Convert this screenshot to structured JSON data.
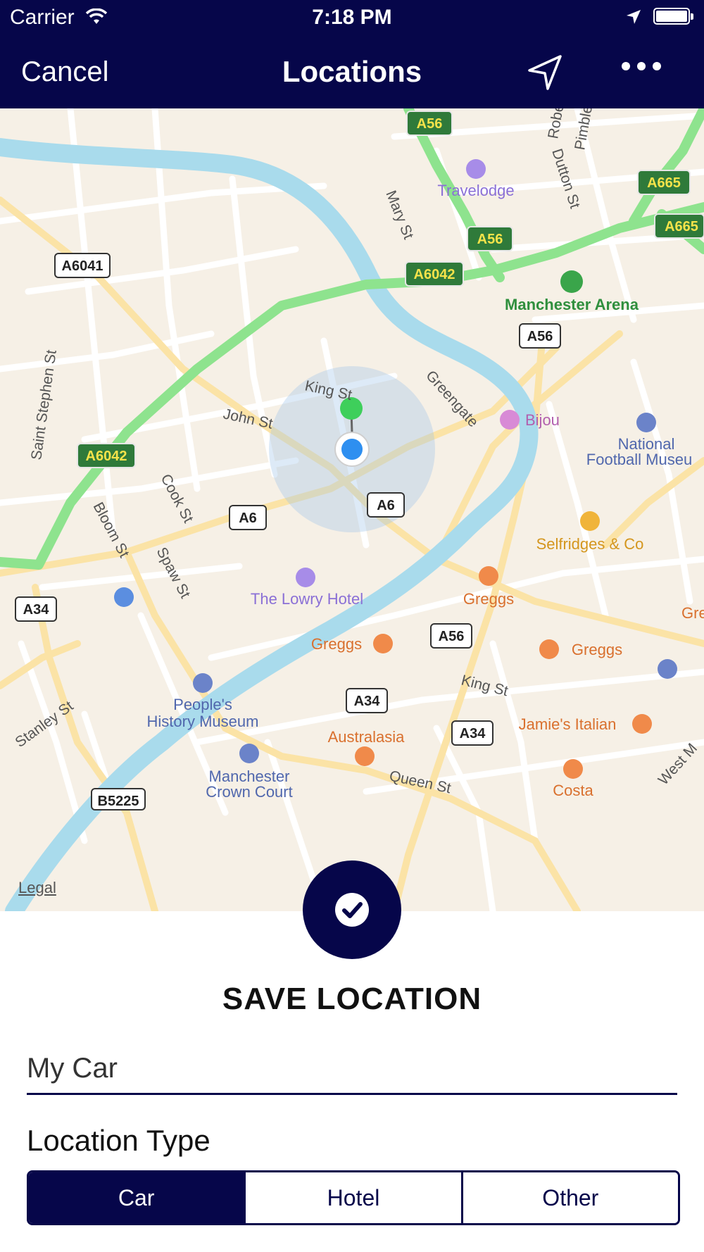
{
  "status_bar": {
    "carrier": "Carrier",
    "time": "7:18 PM"
  },
  "nav": {
    "cancel_label": "Cancel",
    "title": "Locations",
    "location_icon": "navigation-arrow-icon",
    "more_icon": "more-dots-icon"
  },
  "map": {
    "legal": "Legal",
    "road_labels": [
      "A56",
      "A56",
      "A665",
      "A665",
      "A6042",
      "A6041",
      "A56",
      "A6042",
      "A6",
      "A6",
      "A34",
      "A56",
      "A34",
      "A34",
      "B5225"
    ],
    "street_labels": [
      "King St",
      "John St",
      "Greengate",
      "Mary St",
      "Dutton St",
      "Robert",
      "Pimblett",
      "Saint Stephen St",
      "Cook St",
      "Bloom St",
      "Spaw St",
      "Stanley St",
      "King St",
      "Queen St",
      "West M"
    ],
    "poi": {
      "travelodge": "Travelodge",
      "arena": "Manchester Arena",
      "bijou": "Bijou",
      "museum1": "National",
      "museum2": "Football Museu",
      "selfridges": "Selfridges & Co",
      "lowry": "The Lowry Hotel",
      "greggs1": "Greggs",
      "greggs2": "Greggs",
      "greggs3": "Greggs",
      "greggs4": "Gre",
      "history1": "People's",
      "history2": "History Museum",
      "australasia": "Australasia",
      "jamies": "Jamie's Italian",
      "court1": "Manchester",
      "court2": "Crown Court",
      "costa": "Costa"
    },
    "colors": {
      "water": "#a9dbec",
      "main_road": "#8ee38e",
      "secondary_road": "#fbe3a6",
      "land": "#f6f0e6"
    }
  },
  "save": {
    "button_icon": "checkmark-icon",
    "title": "SAVE LOCATION",
    "name_value": "My Car",
    "location_type_label": "Location Type"
  },
  "location_types": [
    {
      "label": "Car",
      "selected": true
    },
    {
      "label": "Hotel",
      "selected": false
    },
    {
      "label": "Other",
      "selected": false
    }
  ],
  "accent_color": "#06064a"
}
